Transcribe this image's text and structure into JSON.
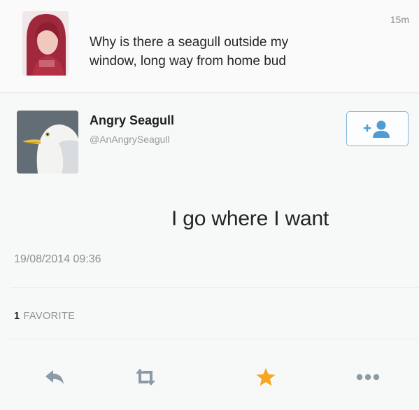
{
  "top_tweet": {
    "time": "15m",
    "text_line1": "Why is there a seagull outside my",
    "text_line2": "window, long way from home bud"
  },
  "main_tweet": {
    "display_name": "Angry Seagull",
    "handle": "@AnAngrySeagull",
    "text": "I go where I want",
    "timestamp": "19/08/2014 09:36",
    "favorites_count": "1",
    "favorites_label": "FAVORITE"
  },
  "icons": {
    "follow": "add-user-icon",
    "reply": "reply-icon",
    "retweet": "retweet-icon",
    "favorite": "star-icon",
    "more": "more-icon"
  },
  "colors": {
    "follow_border": "#7fb6d8",
    "follow_icon": "#4c9dd4",
    "star": "#f5a623",
    "action_gray": "#8a9aa6"
  }
}
